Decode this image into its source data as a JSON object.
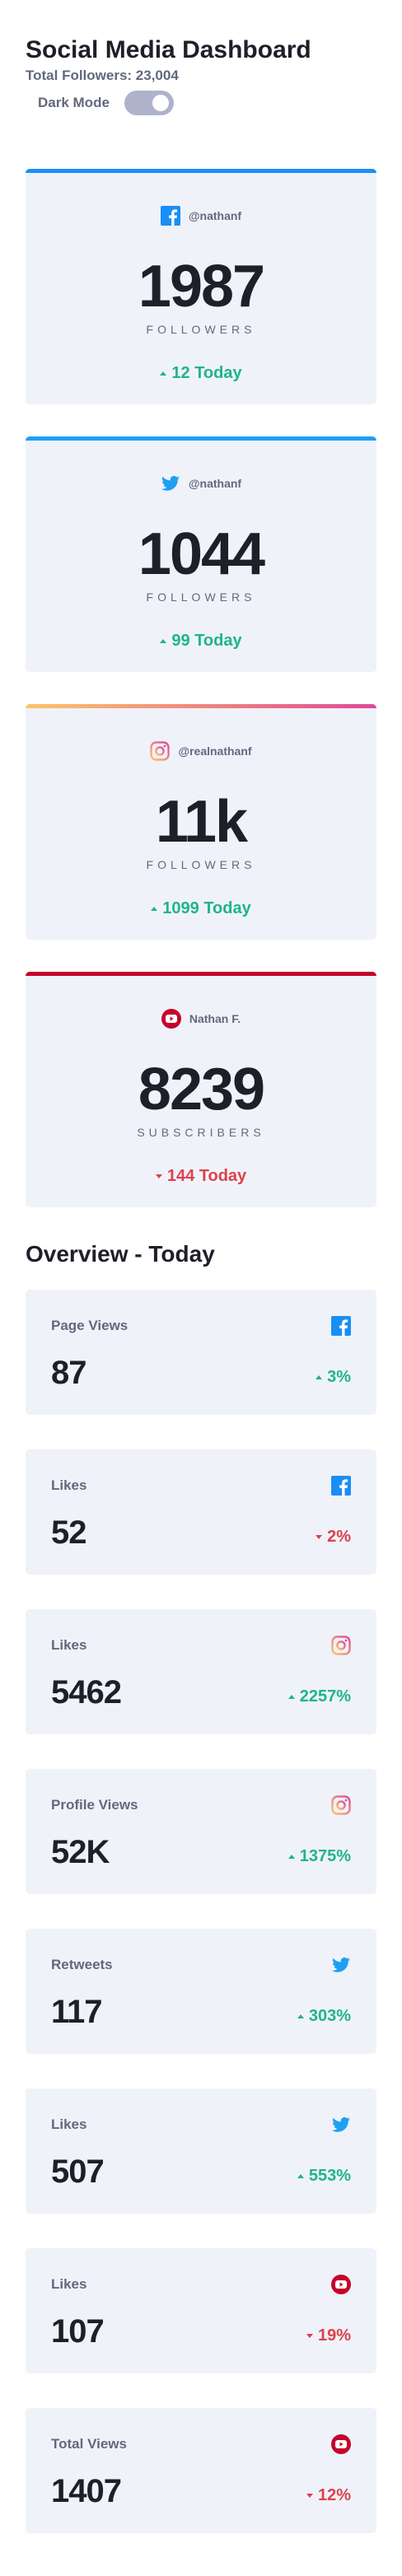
{
  "header": {
    "title": "Social Media Dashboard",
    "total_followers": "Total Followers: 23,004",
    "dark_mode_label": "Dark Mode"
  },
  "colors": {
    "facebook": "#198ff5",
    "twitter": "#1ca0f2",
    "instagram_start": "#fdc468",
    "instagram_end": "#df4996",
    "youtube": "#c4032b",
    "positive": "#1eb589",
    "negative": "#dc414c"
  },
  "follower_cards": [
    {
      "platform": "facebook",
      "icon": "facebook-icon",
      "handle": "@nathanf",
      "count": "1987",
      "label": "FOLLOWERS",
      "change": "12 Today",
      "direction": "up"
    },
    {
      "platform": "twitter",
      "icon": "twitter-icon",
      "handle": "@nathanf",
      "count": "1044",
      "label": "FOLLOWERS",
      "change": "99 Today",
      "direction": "up"
    },
    {
      "platform": "instagram",
      "icon": "instagram-icon",
      "handle": "@realnathanf",
      "count": "11k",
      "label": "FOLLOWERS",
      "change": "1099 Today",
      "direction": "up"
    },
    {
      "platform": "youtube",
      "icon": "youtube-icon",
      "handle": "Nathan F.",
      "count": "8239",
      "label": "SUBSCRIBERS",
      "change": "144 Today",
      "direction": "down"
    }
  ],
  "overview": {
    "title": "Overview - Today",
    "cards": [
      {
        "label": "Page Views",
        "platform": "facebook",
        "icon": "facebook-icon",
        "value": "87",
        "change": "3%",
        "direction": "up"
      },
      {
        "label": "Likes",
        "platform": "facebook",
        "icon": "facebook-icon",
        "value": "52",
        "change": "2%",
        "direction": "down"
      },
      {
        "label": "Likes",
        "platform": "instagram",
        "icon": "instagram-icon",
        "value": "5462",
        "change": "2257%",
        "direction": "up"
      },
      {
        "label": "Profile Views",
        "platform": "instagram",
        "icon": "instagram-icon",
        "value": "52K",
        "change": "1375%",
        "direction": "up"
      },
      {
        "label": "Retweets",
        "platform": "twitter",
        "icon": "twitter-icon",
        "value": "117",
        "change": "303%",
        "direction": "up"
      },
      {
        "label": "Likes",
        "platform": "twitter",
        "icon": "twitter-icon",
        "value": "507",
        "change": "553%",
        "direction": "up"
      },
      {
        "label": "Likes",
        "platform": "youtube",
        "icon": "youtube-icon",
        "value": "107",
        "change": "19%",
        "direction": "down"
      },
      {
        "label": "Total Views",
        "platform": "youtube",
        "icon": "youtube-icon",
        "value": "1407",
        "change": "12%",
        "direction": "down"
      }
    ]
  }
}
